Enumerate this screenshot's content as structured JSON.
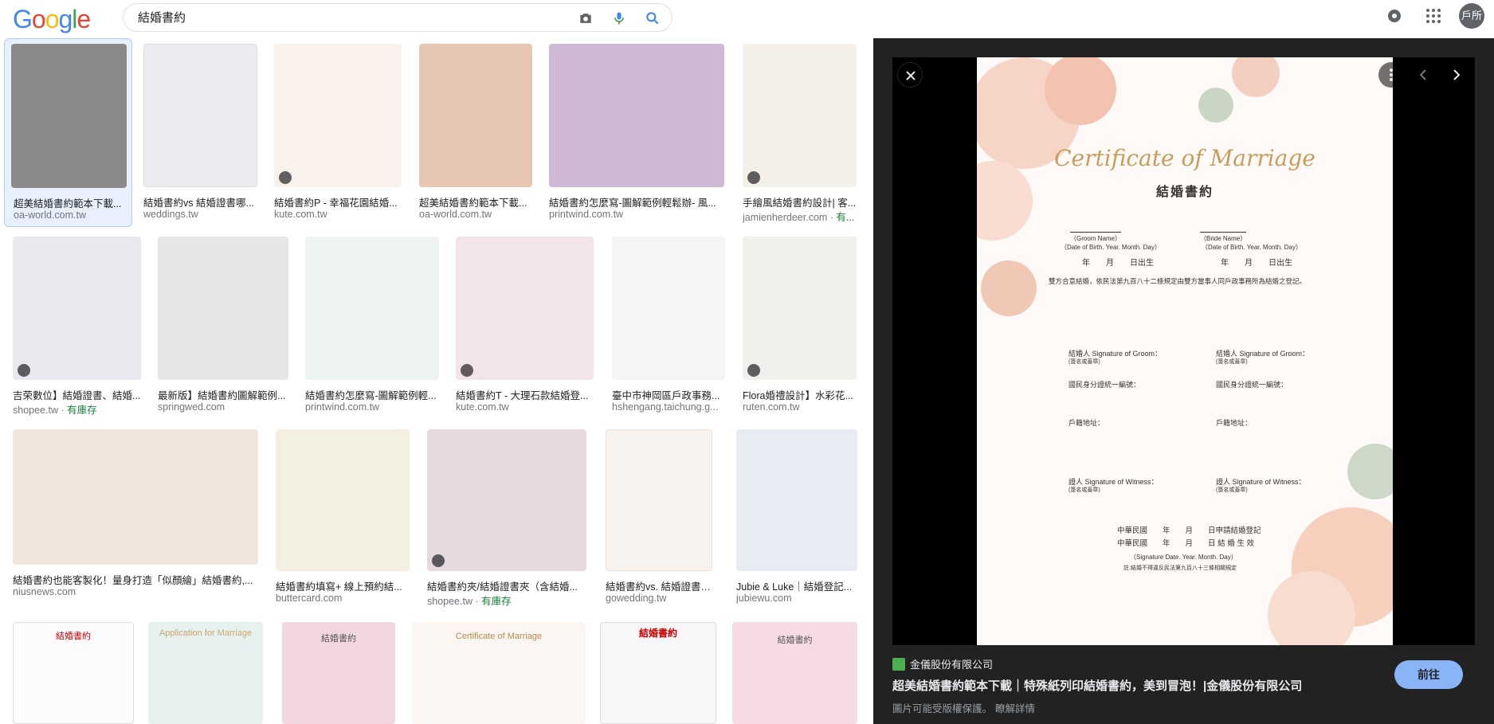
{
  "search": {
    "query": "結婚書約"
  },
  "header": {
    "avatar_text": "戶所"
  },
  "colors": {
    "brand_blue": "#4285f4",
    "visit_button": "#8ab4f8",
    "panel_bg": "#222222",
    "in_stock_green": "#188038"
  },
  "results": [
    {
      "title": "超美結婚書約範本下載...",
      "source": "oa-world.com.tw",
      "stock": ""
    },
    {
      "title": "結婚書約vs 結婚證書哪...",
      "source": "weddings.tw",
      "stock": ""
    },
    {
      "title": "結婚書約P - 幸福花園結婚...",
      "source": "kute.com.tw",
      "stock": ""
    },
    {
      "title": "超美結婚書約範本下載...",
      "source": "oa-world.com.tw",
      "stock": ""
    },
    {
      "title": "結婚書約怎麼寫-圖解範例輕鬆辦- 風...",
      "source": "printwind.com.tw",
      "stock": ""
    },
    {
      "title": "手繪風結婚書約設計| 客...",
      "source": "jamienherdeer.com",
      "stock": "有..."
    },
    {
      "title": "吉荣數位】結婚證書、結婚...",
      "source": "shopee.tw",
      "stock": "有庫存"
    },
    {
      "title": "最新版】結婚書約圖解範例...",
      "source": "springwed.com",
      "stock": ""
    },
    {
      "title": "結婚書約怎麼寫-圖解範例輕...",
      "source": "printwind.com.tw",
      "stock": ""
    },
    {
      "title": "結婚書約T - 大理石款結婚登...",
      "source": "kute.com.tw",
      "stock": ""
    },
    {
      "title": "臺中市神岡區戶政事務...",
      "source": "hshengang.taichung.g...",
      "stock": ""
    },
    {
      "title": "Flora婚禮設計】水彩花...",
      "source": "ruten.com.tw",
      "stock": ""
    },
    {
      "title": "結婚書約也能客製化！量身打造「似顏繪」結婚書約,...",
      "source": "niusnews.com",
      "stock": ""
    },
    {
      "title": "結婚書約填寫+ 線上預約結...",
      "source": "buttercard.com",
      "stock": ""
    },
    {
      "title": "結婚書約夾/結婚證書夾（含結婚...",
      "source": "shopee.tw",
      "stock": "有庫存"
    },
    {
      "title": "結婚書約vs. 結婚證書傻...",
      "source": "gowedding.tw",
      "stock": ""
    },
    {
      "title": "Jubie & Luke｜結婚登記...",
      "source": "jubiewu.com",
      "stock": ""
    }
  ],
  "bottom_row_labels": [
    "結婚書約",
    "Application for Marriage",
    "結婚書約",
    "Certificate of Marriage",
    "結婚書約",
    "結婚書約"
  ],
  "preview": {
    "cert_script": "Certificate of Marriage",
    "cert_title": "結婚書約",
    "groom_name": "（Groom Name）",
    "bride_name": "（Bride Name）",
    "dob": "（Date of Birth. Year. Month. Day）",
    "ymd_birth": "年　　月　　日出生",
    "agreement": "雙方合意結婚，依民法第九百八十二條規定由雙方當事人同戶政事務所為結婚之登記。",
    "groom_sig": "結婚人  Signature of Groom：",
    "bride_sig": "結婚人  Signature of Groom：",
    "sig_note": "(簽名或蓋章)",
    "id_no": "國民身分證統一編號：",
    "address": "戶籍地址：",
    "witness": "證人  Signature of Witness：",
    "roc1": "中華民國　　年　　月　　日申請結婚登記",
    "roc2": "中華民國　　年　　月　　日 結 婚 生 效",
    "sig_date": "（Signature Date. Year. Month. Day）",
    "footnote": "註:結婚不得違反民法第九百八十三條相關規定"
  },
  "meta": {
    "site": "金儀股份有限公司",
    "title": "超美結婚書約範本下載｜特殊紙列印結婚書約，美到冒泡！|金儀股份有限公司",
    "note": "圖片可能受版權保護。",
    "learn_more": "瞭解詳情",
    "visit_label": "前往"
  }
}
